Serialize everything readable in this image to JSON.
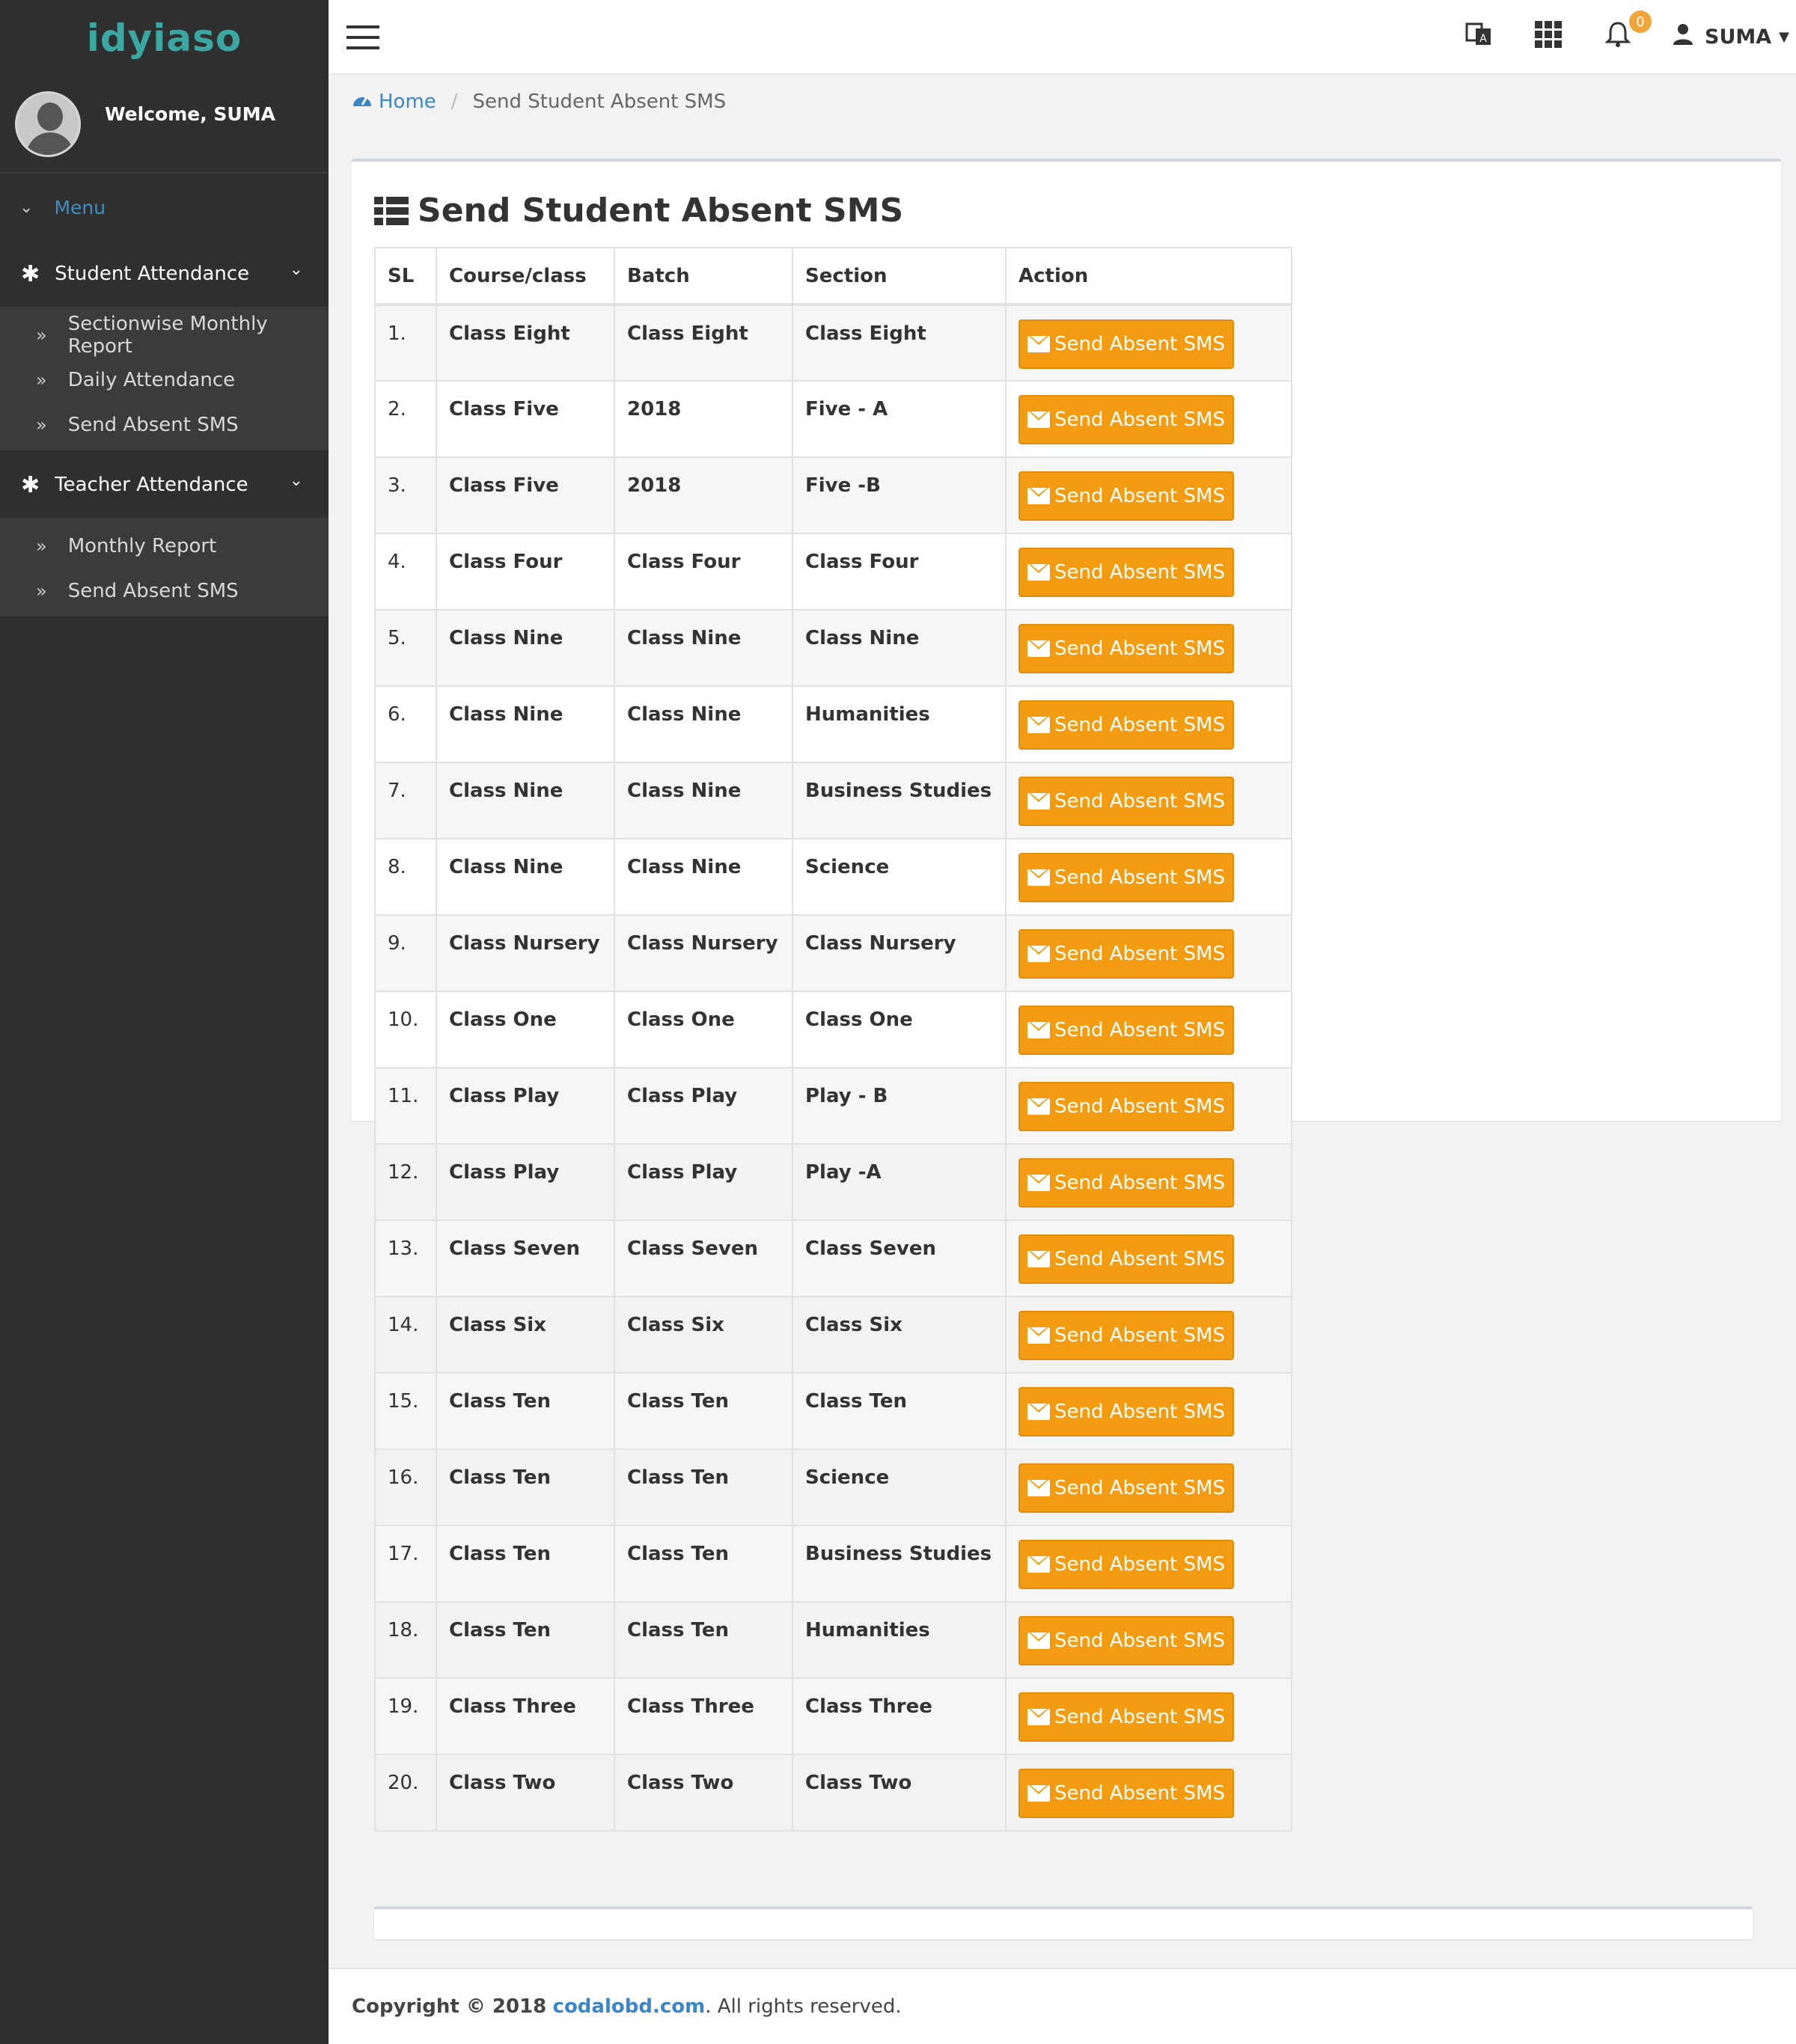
{
  "brand": {
    "logo_text": "idyiaso"
  },
  "user_panel": {
    "welcome": "Welcome, SUMA"
  },
  "menu": {
    "label": "Menu",
    "groups": [
      {
        "title": "Student Attendance",
        "items": [
          "Sectionwise Monthly Report",
          "Daily Attendance",
          "Send Absent SMS"
        ]
      },
      {
        "title": "Teacher Attendance",
        "items": [
          "Monthly Report",
          "Send Absent SMS"
        ]
      }
    ]
  },
  "topbar": {
    "user_name": "SUMA",
    "notification_count": "0"
  },
  "breadcrumb": {
    "home": "Home",
    "current": "Send Student Absent SMS"
  },
  "page": {
    "title": "Send Student Absent SMS",
    "columns": [
      "SL",
      "Course/class",
      "Batch",
      "Section",
      "Action"
    ],
    "action_label": "Send Absent SMS",
    "rows": [
      {
        "sl": "1.",
        "course": "Class Eight",
        "batch": "Class Eight",
        "section": "Class Eight"
      },
      {
        "sl": "2.",
        "course": "Class Five",
        "batch": "2018",
        "section": "Five - A"
      },
      {
        "sl": "3.",
        "course": "Class Five",
        "batch": "2018",
        "section": "Five -B"
      },
      {
        "sl": "4.",
        "course": "Class Four",
        "batch": "Class Four",
        "section": "Class Four"
      },
      {
        "sl": "5.",
        "course": "Class Nine",
        "batch": "Class Nine",
        "section": "Class Nine"
      },
      {
        "sl": "6.",
        "course": "Class Nine",
        "batch": "Class Nine",
        "section": "Humanities"
      },
      {
        "sl": "7.",
        "course": "Class Nine",
        "batch": "Class Nine",
        "section": "Business Studies"
      },
      {
        "sl": "8.",
        "course": "Class Nine",
        "batch": "Class Nine",
        "section": "Science"
      },
      {
        "sl": "9.",
        "course": "Class Nursery",
        "batch": "Class Nursery",
        "section": "Class Nursery"
      },
      {
        "sl": "10.",
        "course": "Class One",
        "batch": "Class One",
        "section": "Class One"
      },
      {
        "sl": "11.",
        "course": "Class Play",
        "batch": "Class Play",
        "section": "Play - B"
      },
      {
        "sl": "12.",
        "course": "Class Play",
        "batch": "Class Play",
        "section": "Play -A"
      },
      {
        "sl": "13.",
        "course": "Class Seven",
        "batch": "Class Seven",
        "section": "Class Seven"
      },
      {
        "sl": "14.",
        "course": "Class Six",
        "batch": "Class Six",
        "section": "Class Six"
      },
      {
        "sl": "15.",
        "course": "Class Ten",
        "batch": "Class Ten",
        "section": "Class Ten"
      },
      {
        "sl": "16.",
        "course": "Class Ten",
        "batch": "Class Ten",
        "section": "Science"
      },
      {
        "sl": "17.",
        "course": "Class Ten",
        "batch": "Class Ten",
        "section": "Business Studies"
      },
      {
        "sl": "18.",
        "course": "Class Ten",
        "batch": "Class Ten",
        "section": "Humanities"
      },
      {
        "sl": "19.",
        "course": "Class Three",
        "batch": "Class Three",
        "section": "Class Three"
      },
      {
        "sl": "20.",
        "course": "Class Two",
        "batch": "Class Two",
        "section": "Class Two"
      }
    ]
  },
  "footer": {
    "copyright": "Copyright © 2018",
    "link": "codalobd.com",
    "suffix": ". All rights reserved."
  },
  "colors": {
    "sidebar_bg": "#2f2f2f",
    "accent": "#3a86c8",
    "button": "#f39c12",
    "badge": "#f0a53a",
    "logo": "#3aa7a3"
  },
  "icons": {
    "translate": "translate-icon",
    "apps": "apps-grid-icon",
    "notifications": "bell-icon",
    "user": "user-icon",
    "home": "dashboard-icon",
    "title": "list-icon",
    "action": "envelope-icon",
    "group": "asterisk-icon",
    "sub_item": "double-chevron-right-icon"
  }
}
